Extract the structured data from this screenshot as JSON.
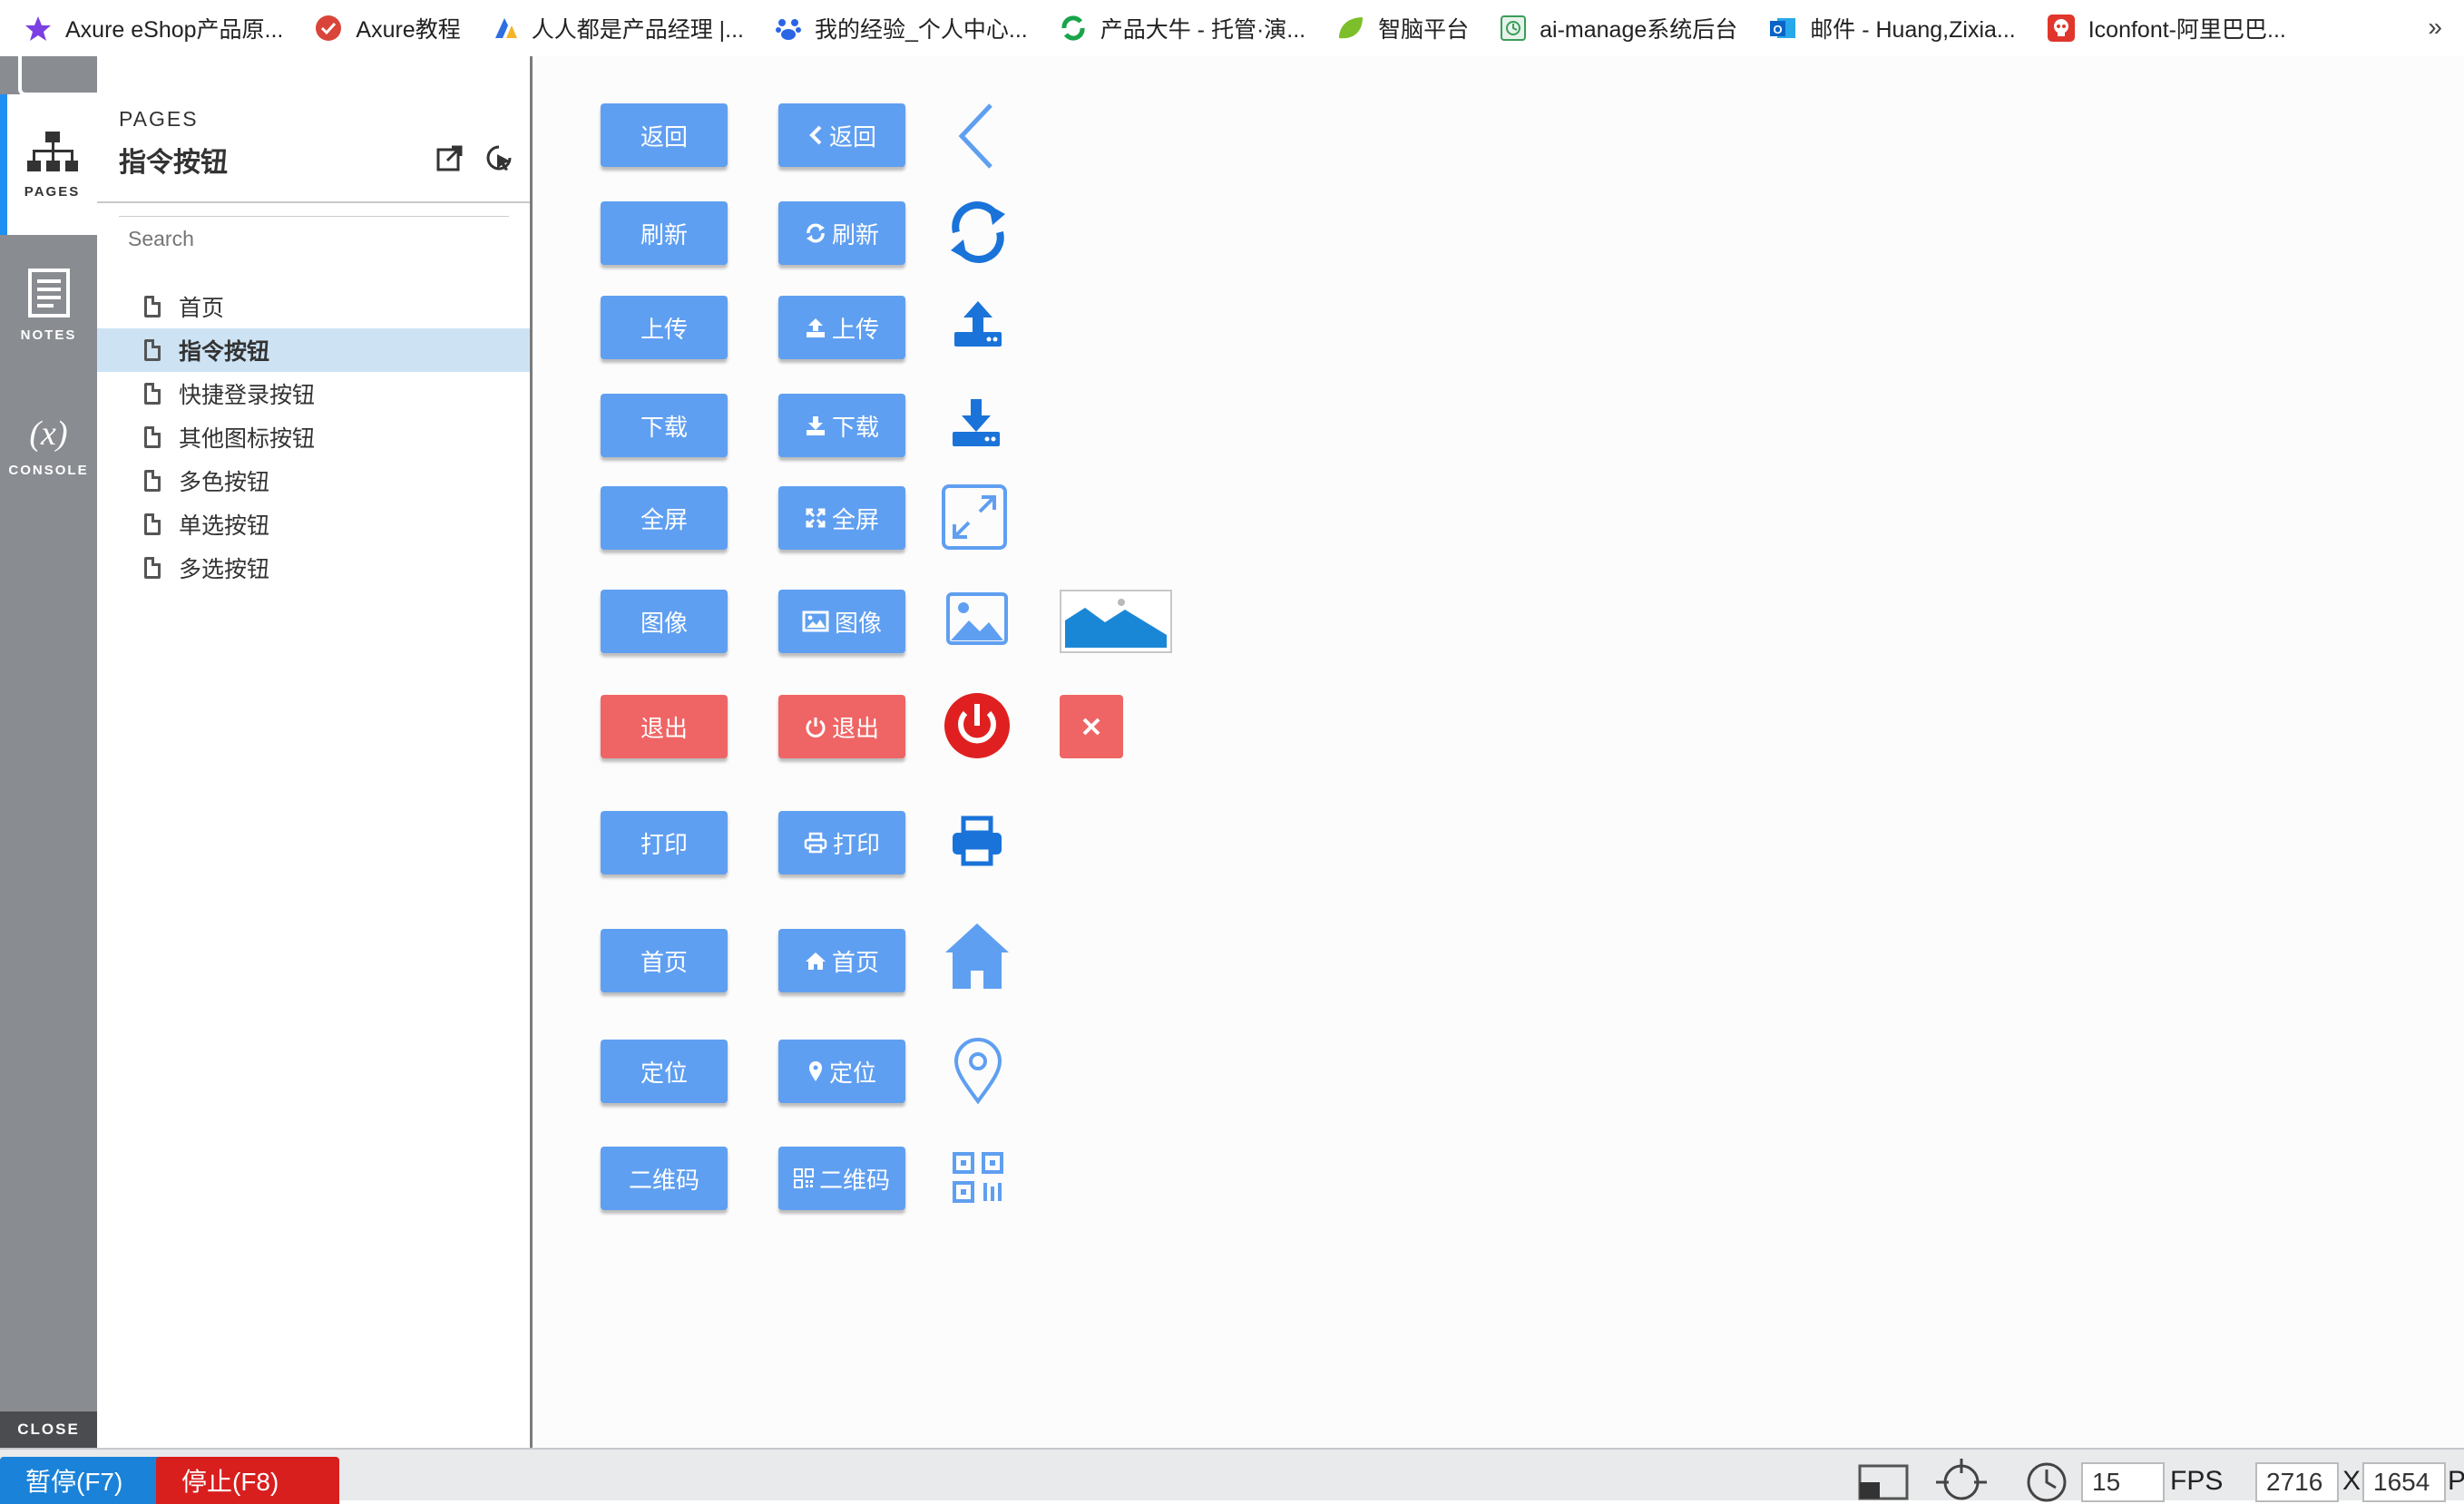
{
  "bookmarks": [
    {
      "label": "Axure eShop产品原...",
      "icon": "star-icon",
      "color": "#7b3fe4"
    },
    {
      "label": "Axure教程",
      "icon": "check-circle-icon",
      "color": "#d9453a"
    },
    {
      "label": "人人都是产品经理 |...",
      "icon": "pm-logo-icon",
      "color": "#2f6fe0"
    },
    {
      "label": "我的经验_个人中心...",
      "icon": "paw-icon",
      "color": "#2a66e4"
    },
    {
      "label": "产品大牛 - 托管·演...",
      "icon": "refresh-leaf-icon",
      "color": "#18a44a"
    },
    {
      "label": "智脑平台",
      "icon": "leaf-icon",
      "color": "#7cbf2b"
    },
    {
      "label": "ai-manage系统后台",
      "icon": "doc-clock-icon",
      "color": "#3a9d5a"
    },
    {
      "label": "邮件 - Huang,Zixia...",
      "icon": "outlook-icon",
      "color": "#0a64c8"
    },
    {
      "label": "Iconfont-阿里巴巴...",
      "icon": "skull-icon",
      "color": "#e0362c"
    }
  ],
  "bookmarks_more": "»",
  "rail": {
    "pages": "PAGES",
    "notes": "NOTES",
    "console_glyph": "(x)",
    "console": "CONSOLE",
    "close": "CLOSE"
  },
  "panel": {
    "label": "PAGES",
    "title": "指令按钮",
    "search_placeholder": "Search",
    "pages": [
      "首页",
      "指令按钮",
      "快捷登录按钮",
      "其他图标按钮",
      "多色按钮",
      "单选按钮",
      "多选按钮"
    ],
    "selected_index": 1
  },
  "canvas": {
    "rows": [
      {
        "plain": "返回",
        "icon_label": "返回",
        "icon": "chevron-left-icon",
        "big_icon": "arrow-left-icon"
      },
      {
        "plain": "刷新",
        "icon_label": "刷新",
        "icon": "refresh-icon",
        "big_icon": "sync-icon"
      },
      {
        "plain": "上传",
        "icon_label": "上传",
        "icon": "upload-icon",
        "big_icon": "upload-tray-icon"
      },
      {
        "plain": "下载",
        "icon_label": "下载",
        "icon": "download-icon",
        "big_icon": "download-tray-icon"
      },
      {
        "plain": "全屏",
        "icon_label": "全屏",
        "icon": "expand-icon",
        "big_icon": "fullscreen-icon"
      },
      {
        "plain": "图像",
        "icon_label": "图像",
        "icon": "picture-icon",
        "big_icon": "image-icon"
      },
      {
        "plain": "退出",
        "icon_label": "退出",
        "icon": "power-icon",
        "big_icon": "power-button-icon"
      },
      {
        "plain": "打印",
        "icon_label": "打印",
        "icon": "print-icon",
        "big_icon": "printer-icon"
      },
      {
        "plain": "首页",
        "icon_label": "首页",
        "icon": "home-icon",
        "big_icon": "house-icon"
      },
      {
        "plain": "定位",
        "icon_label": "定位",
        "icon": "marker-icon",
        "big_icon": "location-pin-icon"
      },
      {
        "plain": "二维码",
        "icon_label": "二维码",
        "icon": "qrcode-icon",
        "big_icon": "qr-code-icon"
      }
    ],
    "colors": {
      "blue": "#5f9ff1",
      "red": "#ef6565",
      "power_red": "#e02020"
    }
  },
  "statusbar": {
    "pause": "暂停(F7)",
    "stop": "停止(F8)",
    "fps_value": "15",
    "fps_label": "FPS",
    "width": "2716",
    "x": "X",
    "height": "1654",
    "unit": "P"
  }
}
